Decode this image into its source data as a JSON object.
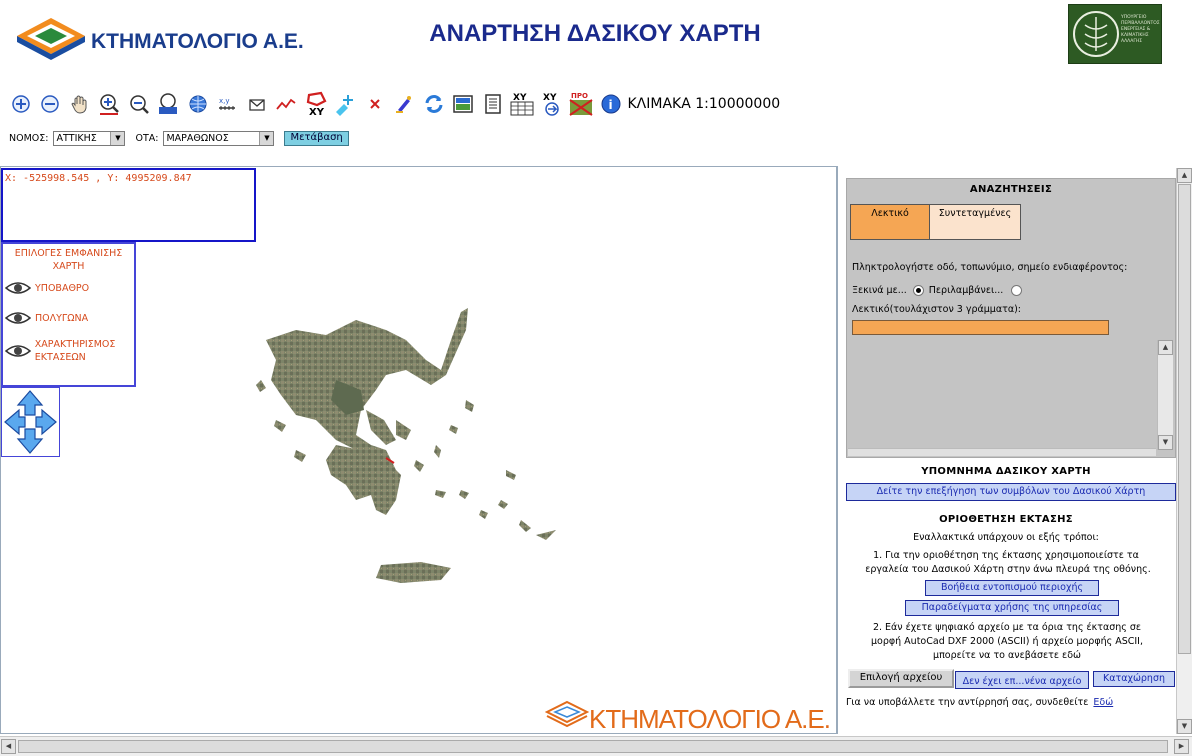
{
  "header": {
    "logo_text": "ΚΤΗΜΑΤΟΛΟΓΙΟ Α.Ε.",
    "page_title": "ΑΝΑΡΤΗΣΗ ΔΑΣΙΚΟΥ ΧΑΡΤΗ",
    "ministry_text": "ΥΠΟΥΡΓΕΙΟ ΠΕΡΙΒΑΛΛΟΝΤΟΣ ΕΝΕΡΓΕΙΑΣ & ΚΛΙΜΑΤΙΚΗΣ ΑΛΛΑΓΗΣ"
  },
  "toolbar": {
    "tools": [
      "zoom-in-icon",
      "zoom-out-icon",
      "pan-hand-icon",
      "zoom-box-in-icon",
      "zoom-box-out-icon",
      "full-extent-icon",
      "globe-icon",
      "measure-distance-icon",
      "measure-area-icon",
      "draw-line-icon",
      "draw-polygon-xy-icon",
      "add-point-icon",
      "delete-icon",
      "edit-icon",
      "refresh-icon",
      "layers-icon",
      "report-icon",
      "xy-table-icon",
      "xy-goto-icon",
      "pro-print-icon",
      "info-icon"
    ],
    "scale_label": "ΚΛΙΜΑΚΑ 1:10000000"
  },
  "location": {
    "nomos_label": "ΝΟΜΟΣ:",
    "nomos_value": "ΑΤΤΙΚΗΣ",
    "ota_label": "ΟΤΑ:",
    "ota_value": "ΜΑΡΑΘΩΝΟΣ",
    "goto_label": "Μετάβαση"
  },
  "map": {
    "coords": "X: -525998.545 , Y: 4995209.847",
    "layers_title": "ΕΠΙΛΟΓΕΣ ΕΜΦΑΝΙΣΗΣ ΧΑΡΤΗ",
    "layers": [
      "ΥΠΟΒΑΘΡΟ",
      "ΠΟΛΥΓΩΝΑ",
      "ΧΑΡΑΚΤΗΡΙΣΜΟΣ ΕΚΤΑΣΕΩΝ"
    ],
    "watermark": "ΚΤΗΜΑΤΟΛΟΓΙΟ Α.Ε."
  },
  "search": {
    "title": "ΑΝΑΖΗΤΗΣΕΙΣ",
    "tab_text": "Λεκτικό",
    "tab_coords": "Συντεταγμένες",
    "prompt": "Πληκτρολογήστε οδό, τοπωνύμιο, σημείο ενδιαφέροντος:",
    "starts_with": "Ξεκινά με...",
    "contains": "Περιλαμβάνει...",
    "input_label": "Λεκτικό(τουλάχιστον 3 γράμματα):",
    "input_value": ""
  },
  "legend": {
    "title": "ΥΠΟΜΝΗΜΑ ΔΑΣΙΚΟΥ ΧΑΡΤΗ",
    "button": "Δείτε την επεξήγηση των συμβόλων του Δασικού Χάρτη"
  },
  "delimit": {
    "title": "ΟΡΙΟΘΕΤΗΣΗ ΕΚΤΑΣΗΣ",
    "intro": "Εναλλακτικά υπάρχουν οι εξής τρόποι:",
    "option1_line1": "1. Για την οριοθέτηση της έκτασης χρησιμοποιείστε τα",
    "option1_line2": "εργαλεία του Δασικού Χάρτη στην άνω πλευρά της οθόνης.",
    "help_button": "Βοήθεια εντοπισμού περιοχής",
    "examples_button": "Παραδείγματα χρήσης της υπηρεσίας",
    "option2_line1": "2. Εάν έχετε ψηφιακό αρχείο με τα όρια της έκτασης σε",
    "option2_line2": "μορφή AutoCad DXF 2000 (ASCII) ή αρχείο μορφής ASCII,",
    "option2_line3": "μπορείτε να το ανεβάσετε εδώ",
    "choose_file": "Επιλογή αρχείου",
    "no_file": "Δεν έχει επ...νένα αρχείο",
    "submit": "Καταχώρηση",
    "objection_text": "Για να υποβάλλετε την αντίρρησή σας, συνδεθείτε",
    "objection_link": "Εδώ"
  },
  "colors": {
    "orange": "#f5a654",
    "peach": "#fbe3cd",
    "navy": "#1a2a8c",
    "brand_orange": "#e26b1a"
  }
}
